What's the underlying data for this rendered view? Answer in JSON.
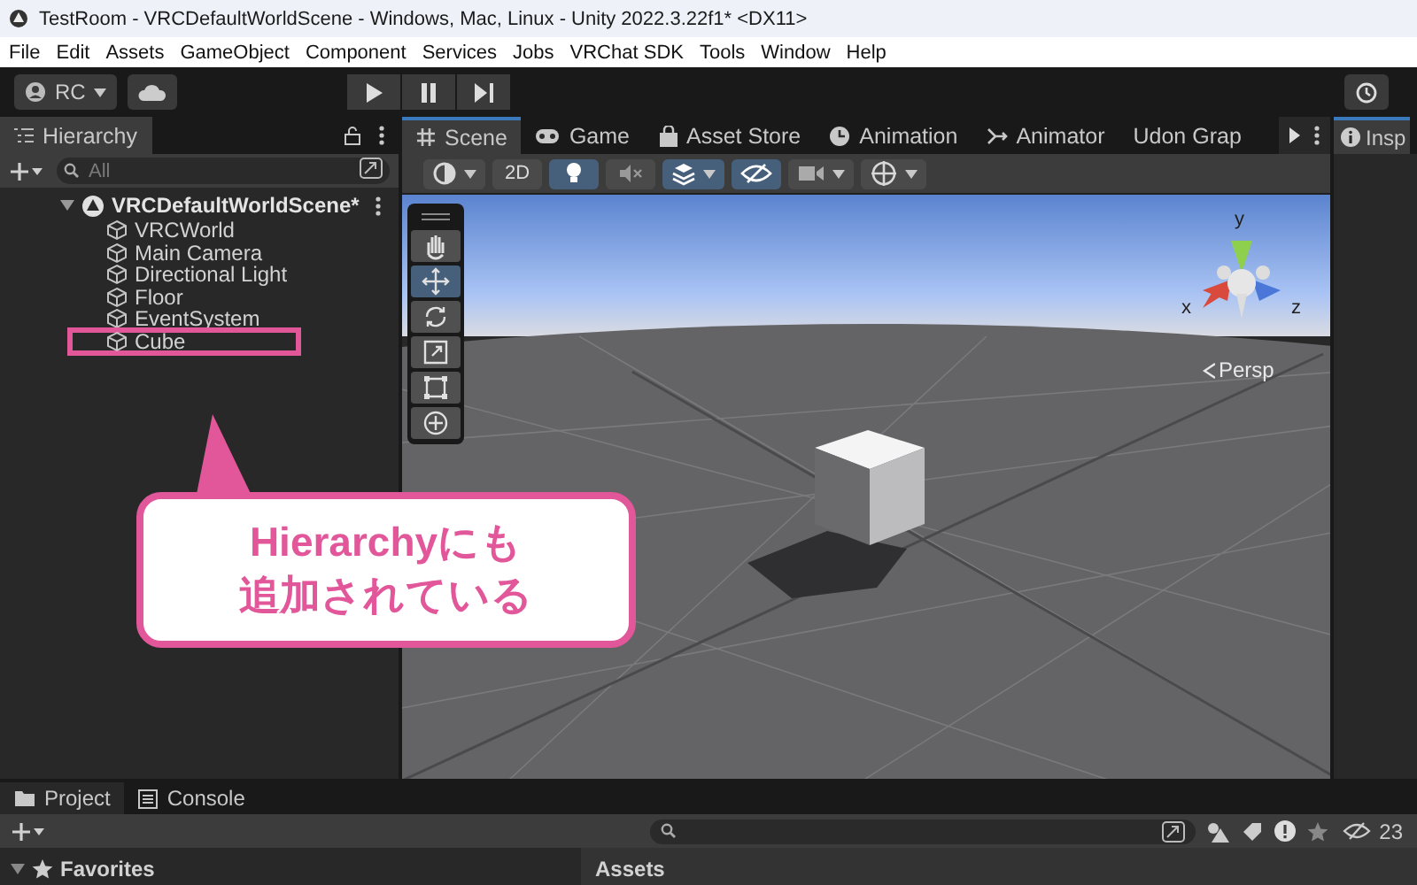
{
  "window": {
    "title": "TestRoom - VRCDefaultWorldScene - Windows, Mac, Linux - Unity 2022.3.22f1* <DX11>"
  },
  "menu": [
    "File",
    "Edit",
    "Assets",
    "GameObject",
    "Component",
    "Services",
    "Jobs",
    "VRChat SDK",
    "Tools",
    "Window",
    "Help"
  ],
  "toolbar": {
    "account": "RC"
  },
  "hierarchy": {
    "tab": "Hierarchy",
    "search": {
      "placeholder": "All"
    },
    "root": {
      "label": "VRCDefaultWorldScene*",
      "expanded": true,
      "children": [
        {
          "label": "VRCWorld",
          "highlighted": false
        },
        {
          "label": "Main Camera",
          "highlighted": false
        },
        {
          "label": "Directional Light",
          "highlighted": false
        },
        {
          "label": "Floor",
          "highlighted": false
        },
        {
          "label": "EventSystem",
          "highlighted": false
        },
        {
          "label": "Cube",
          "highlighted": true
        }
      ]
    }
  },
  "scene_tabs": [
    {
      "label": "Scene",
      "kind": "scene",
      "selected": true
    },
    {
      "label": "Game",
      "kind": "game",
      "selected": false
    },
    {
      "label": "Asset Store",
      "kind": "store",
      "selected": false
    },
    {
      "label": "Animation",
      "kind": "animation",
      "selected": false
    },
    {
      "label": "Animator",
      "kind": "animator",
      "selected": false
    },
    {
      "label": "Udon Grap",
      "kind": "plain",
      "selected": false
    }
  ],
  "scene_toolbar": [
    {
      "kind": "shading",
      "on": false
    },
    {
      "kind": "text",
      "label": "2D",
      "on": false
    },
    {
      "kind": "light",
      "on": true
    },
    {
      "kind": "audio",
      "on": false
    },
    {
      "kind": "effects",
      "on": true
    },
    {
      "kind": "visibility",
      "on": true
    },
    {
      "kind": "camera",
      "on": false
    },
    {
      "kind": "gizmos",
      "on": false
    }
  ],
  "tools": [
    {
      "kind": "hand",
      "selected": false
    },
    {
      "kind": "move",
      "selected": true
    },
    {
      "kind": "rotate",
      "selected": false
    },
    {
      "kind": "scale",
      "selected": false
    },
    {
      "kind": "rect",
      "selected": false
    },
    {
      "kind": "transform",
      "selected": false
    }
  ],
  "gizmo": {
    "x": "x",
    "y": "y",
    "z": "z",
    "projection": "Persp"
  },
  "inspector": {
    "tab": "Insp"
  },
  "callout": {
    "lines": [
      "Hierarchyにも",
      "追加されている"
    ]
  },
  "project": {
    "tabs": [
      {
        "label": "Project",
        "kind": "project",
        "selected": true
      },
      {
        "label": "Console",
        "kind": "console",
        "selected": false
      }
    ],
    "hidden_count": "23",
    "favorites": "Favorites",
    "assets": "Assets"
  }
}
